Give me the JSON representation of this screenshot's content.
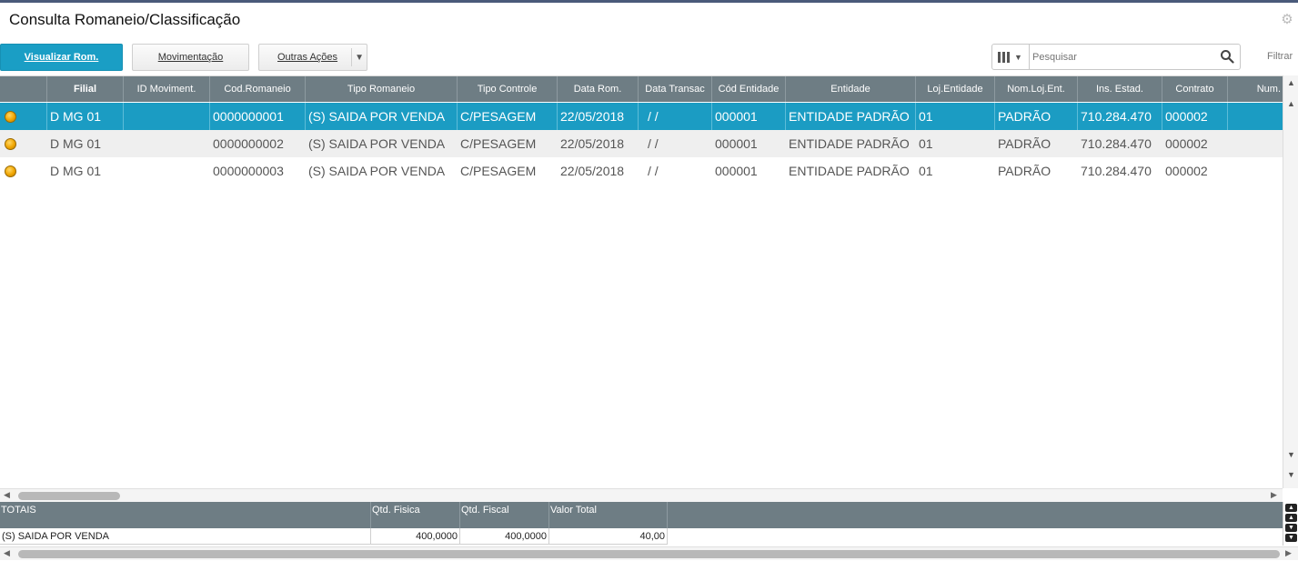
{
  "title": "Consulta Romaneio/Classificação",
  "toolbar": {
    "visualizar_label": "Visualizar Rom.",
    "movimentacao_label": "Movimentação",
    "outras_label": "Outras Ações"
  },
  "search": {
    "placeholder": "Pesquisar",
    "filter_label": "Filtrar"
  },
  "grid": {
    "columns": [
      "",
      "Filial",
      "ID Moviment.",
      "Cod.Romaneio",
      "Tipo Romaneio",
      "Tipo Controle",
      "Data Rom.",
      "Data Transac",
      "Cód Entidade",
      "Entidade",
      "Loj.Entidade",
      "Nom.Loj.Ent.",
      "Ins. Estad.",
      "Contrato",
      "Num."
    ],
    "rows": [
      {
        "status_icon": "yellow-status-icon",
        "filial": "D MG 01",
        "id_moviment": "",
        "cod_romaneio": "0000000001",
        "tipo_romaneio": "(S) SAIDA POR VENDA",
        "tipo_controle": "C/PESAGEM",
        "data_rom": "22/05/2018",
        "data_transac": "/  /",
        "cod_entidade": "000001",
        "entidade": "ENTIDADE PADRÃO",
        "loj_entidade": "01",
        "nom_loj_ent": "PADRÃO",
        "ins_estad": "710.284.470",
        "contrato": "000002",
        "num": ""
      },
      {
        "status_icon": "yellow-status-icon",
        "filial": "D MG 01",
        "id_moviment": "",
        "cod_romaneio": "0000000002",
        "tipo_romaneio": "(S) SAIDA POR VENDA",
        "tipo_controle": "C/PESAGEM",
        "data_rom": "22/05/2018",
        "data_transac": "/  /",
        "cod_entidade": "000001",
        "entidade": "ENTIDADE PADRÃO",
        "loj_entidade": "01",
        "nom_loj_ent": "PADRÃO",
        "ins_estad": "710.284.470",
        "contrato": "000002",
        "num": ""
      },
      {
        "status_icon": "yellow-status-icon",
        "filial": "D MG 01",
        "id_moviment": "",
        "cod_romaneio": "0000000003",
        "tipo_romaneio": "(S) SAIDA POR VENDA",
        "tipo_controle": "C/PESAGEM",
        "data_rom": "22/05/2018",
        "data_transac": "/  /",
        "cod_entidade": "000001",
        "entidade": "ENTIDADE PADRÃO",
        "loj_entidade": "01",
        "nom_loj_ent": "PADRÃO",
        "ins_estad": "710.284.470",
        "contrato": "000002",
        "num": ""
      }
    ]
  },
  "totals": {
    "headers": [
      "TOTAIS",
      "Qtd. Fisica",
      "Qtd. Fiscal",
      "Valor Total"
    ],
    "row": [
      "(S) SAIDA POR VENDA",
      "400,0000",
      "400,0000",
      "40,00"
    ]
  },
  "colors": {
    "accent": "#1b9cc3",
    "header": "#6e7d84",
    "status_yellow": "#f0a500"
  }
}
